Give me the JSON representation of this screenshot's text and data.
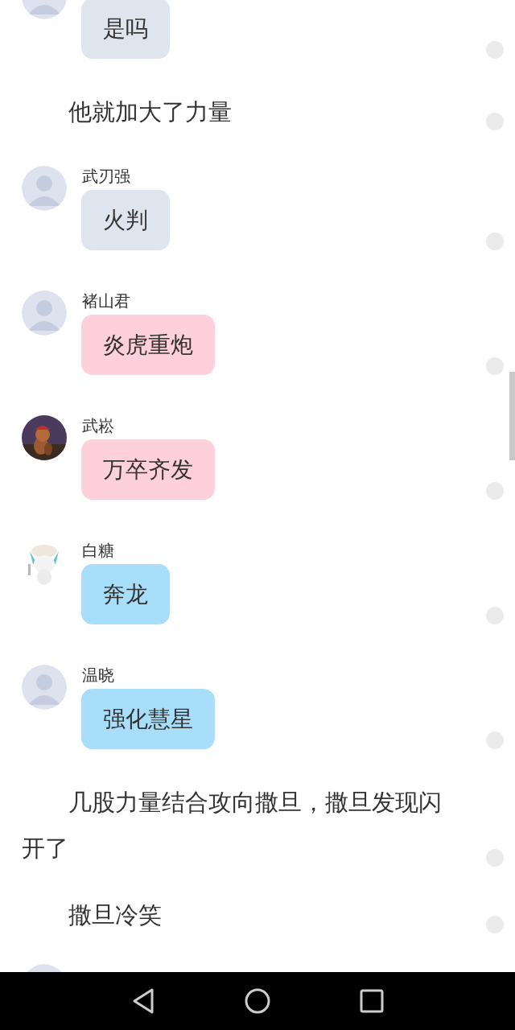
{
  "feed": [
    {
      "kind": "message",
      "avatar": {
        "kind": "default"
      },
      "text": "是吗",
      "color": "#dfe5ee"
    },
    {
      "kind": "narration",
      "text": "他就加大了力量"
    },
    {
      "kind": "message",
      "name": "武刃强",
      "avatar": {
        "kind": "default"
      },
      "text": "火判",
      "color": "#dfe5ee"
    },
    {
      "kind": "message",
      "name": "褚山君",
      "avatar": {
        "kind": "default"
      },
      "text": "炎虎重炮",
      "color": "#fdd0dc"
    },
    {
      "kind": "message",
      "name": "武崧",
      "text": "万卒齐发",
      "color": "#fdd0dc"
    },
    {
      "kind": "message",
      "name": "白糖",
      "text": "奔龙",
      "color": "#a9defa"
    },
    {
      "kind": "message",
      "name": "温晓",
      "avatar": {
        "kind": "default"
      },
      "text": "强化慧星",
      "color": "#a9defa"
    },
    {
      "kind": "narration",
      "text": "几股力量结合攻向撒旦，撒旦发现闪开了"
    },
    {
      "kind": "narration",
      "text": "撒旦冷笑"
    },
    {
      "kind": "message",
      "avatar": {
        "kind": "default"
      }
    }
  ]
}
